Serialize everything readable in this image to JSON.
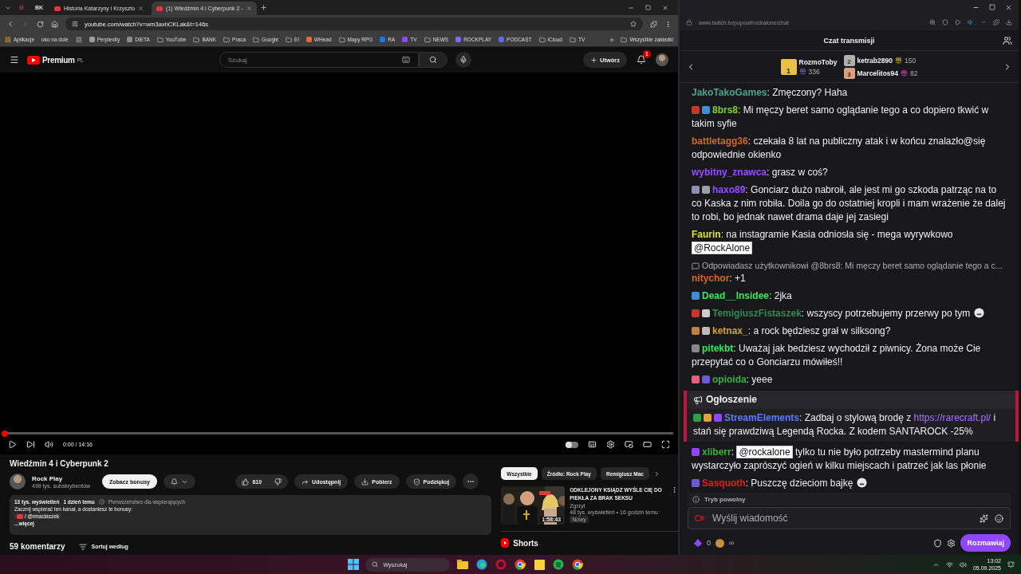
{
  "browser": {
    "tabs": [
      {
        "kind": "pinned",
        "label": "G",
        "selected": false
      },
      {
        "kind": "pinned",
        "label": "BK",
        "selected": false
      },
      {
        "kind": "page",
        "label": "Historia Katarzyny i Krzyszto",
        "selected": false
      },
      {
        "kind": "page",
        "label": "(1) Wiedźmin 4 i Cyberpunk 2 -",
        "selected": true
      }
    ],
    "url": "youtube.com/watch?v=wm3axhCKLak&t=146s",
    "bookmarks": [
      {
        "kind": "apps",
        "label": "Aplikacje"
      },
      {
        "kind": "text",
        "label": "oko na dole"
      },
      {
        "kind": "grid"
      },
      {
        "kind": "site",
        "label": "Perplexity",
        "color": "#9aa0a6"
      },
      {
        "kind": "site",
        "label": "DIETA",
        "color": "#8d8d8d"
      },
      {
        "kind": "folder",
        "label": "YouTube"
      },
      {
        "kind": "folder",
        "label": "BANK"
      },
      {
        "kind": "folder",
        "label": "Praca"
      },
      {
        "kind": "folder",
        "label": "Google"
      },
      {
        "kind": "folder",
        "label": "El"
      },
      {
        "kind": "site",
        "label": "WHead",
        "color": "#e06a3a"
      },
      {
        "kind": "folder",
        "label": "Mapy RPG"
      },
      {
        "kind": "site",
        "label": "RA",
        "color": "#1877f2"
      },
      {
        "kind": "site",
        "label": "TV",
        "color": "#9146ff"
      },
      {
        "kind": "folder",
        "label": "NEWS"
      },
      {
        "kind": "site",
        "label": "ROCKPLAY",
        "color": "#7b6cf0"
      },
      {
        "kind": "site",
        "label": "PODCAST",
        "color": "#5b6cf0"
      },
      {
        "kind": "folder",
        "label": "iCloud"
      },
      {
        "kind": "folder",
        "label": "TV"
      }
    ],
    "more_bookmarks": "»",
    "all_bookmarks": "Wszystkie zakładki"
  },
  "youtube": {
    "logo": "Premium",
    "region": "PL",
    "search_placeholder": "Szukaj",
    "create": "Utwórz",
    "notifications": "1",
    "player": {
      "level": 0,
      "time": "0:00 / 14:16"
    },
    "video": {
      "title": "Wiedźmin 4 i Cyberpunk 2",
      "channel": "Rock Play",
      "subscribers": "499 tys. subskrybentów",
      "bonus_button": "Zobacz bonusy",
      "likes": "610",
      "actions": [
        {
          "kind": "share",
          "label": "Udostępnij"
        },
        {
          "kind": "download",
          "label": "Pobierz"
        },
        {
          "kind": "thanks",
          "label": "Podziękuj"
        }
      ]
    },
    "description": {
      "views": "13 tys. wyświetleń",
      "age": "1 dzień temu",
      "priority": "Pierwszeństwo dla wspierających",
      "line": "Zacznij wspierać ten kanał, a dostaniesz te bonusy:",
      "handle": "/ @rmaciaszek",
      "more": "...więcej"
    },
    "comments": {
      "count": "59 komentarzy",
      "sort": "Sortuj według"
    },
    "chips": [
      {
        "label": "Wszystkie",
        "selected": true
      },
      {
        "label": "Źródło: Rock Play",
        "selected": false
      },
      {
        "label": "Remigiusz Mac",
        "selected": false
      }
    ],
    "recommended": [
      {
        "title": "ODKLEJONY KSIĄDZ WYŚLE CIĘ DO PIEKŁA ZA BRAK SEKSU",
        "channel": "Zgrzyt",
        "meta": "48 tys. wyświetleń • 16 godzin temu",
        "badge": "Nowy",
        "duration": "1:58:43"
      }
    ],
    "shorts": "Shorts"
  },
  "twitch": {
    "url": "www.twitch.tv/popout/rockalone/chat",
    "title": "Czat transmisji",
    "separator": ":",
    "leaders": [
      {
        "rank": "1",
        "name": "RozmoToby",
        "count": "336"
      },
      {
        "rank": "2",
        "name": "ketrab2890",
        "count": "150"
      },
      {
        "rank": "3",
        "name": "Marcelitos94",
        "count": "82"
      }
    ],
    "chat": [
      {
        "kind": "message",
        "user": "JakoTakoGames",
        "color": "#4fa28e",
        "parts": [
          {
            "kind": "text",
            "text": "Zmęczony? Haha"
          }
        ]
      },
      {
        "kind": "message",
        "user": "8brs8",
        "color": "#7fd13b",
        "badges": [
          {
            "color": "#c0392b"
          },
          {
            "color": "#3a8fd6"
          }
        ],
        "parts": [
          {
            "kind": "text",
            "text": "Mi męczy beret samo oglądanie tego a co dopiero tkwić w takim syfie"
          }
        ]
      },
      {
        "kind": "message",
        "user": "battletagg36",
        "color": "#d2692a",
        "parts": [
          {
            "kind": "text",
            "text": "czekała 8 lat na publiczny atak i w końcu znalazło@się odpowiednie okienko"
          }
        ]
      },
      {
        "kind": "message",
        "user": "wybitny_znawca",
        "color": "#9a4dff",
        "parts": [
          {
            "kind": "text",
            "text": "grasz w coś?"
          }
        ]
      },
      {
        "kind": "message",
        "user": "haxo89",
        "color": "#9a4dff",
        "badges": [
          {
            "color": "#8a8fb0"
          },
          {
            "color": "#9aa0a6"
          }
        ],
        "parts": [
          {
            "kind": "text",
            "text": "Gonciarz dużo nabroił, ale jest mi go szkoda patrząc na to co Kaska z nim robiła. Doila go do ostatniej kropli i mam wrażenie że dalej to robi, bo jednak nawet drama daje jej zasiegi"
          }
        ]
      },
      {
        "kind": "message",
        "user": "Faurin",
        "color": "#dfe32d",
        "parts": [
          {
            "kind": "text",
            "text": "na instagramie Kasia odniosła się - mega wyrywkowo"
          },
          {
            "kind": "mention",
            "text": "@RockAlone"
          }
        ]
      },
      {
        "kind": "reply",
        "text": "Odpowiadasz użytkownikowi @8brs8: Mi męczy beret samo oglądanie tego a c..."
      },
      {
        "kind": "message",
        "user": "nitychor",
        "color": "#d2692a",
        "parts": [
          {
            "kind": "text",
            "text": "+1"
          }
        ]
      },
      {
        "kind": "message",
        "user": "Dead__Insidee",
        "color": "#3ee65a",
        "badges": [
          {
            "color": "#3a8fd6"
          }
        ],
        "parts": [
          {
            "kind": "text",
            "text": "2jka"
          }
        ]
      },
      {
        "kind": "message",
        "user": "TemigiuszFistaszek",
        "color": "#2e8b57",
        "badges": [
          {
            "color": "#c0392b"
          },
          {
            "color": "#cccccc"
          }
        ],
        "parts": [
          {
            "kind": "text",
            "text": "wszyscy potrzebujemy przerwy po tym"
          },
          {
            "kind": "emote"
          }
        ]
      },
      {
        "kind": "message",
        "user": "ketnax_",
        "color": "#d4a52a",
        "badges": [
          {
            "color": "#c08040"
          },
          {
            "color": "#bbbbbb"
          }
        ],
        "parts": [
          {
            "kind": "text",
            "text": "a rock będziesz grał w silksong?"
          }
        ]
      },
      {
        "kind": "message",
        "user": "pitekbt",
        "color": "#3ee65a",
        "badges": [
          {
            "color": "#888888"
          }
        ],
        "parts": [
          {
            "kind": "text",
            "text": "Uważaj jak bedziesz wychodził z piwnicy. Żona może Cie przepytać co o Gonciarzu mówiłeś!!"
          }
        ]
      },
      {
        "kind": "message",
        "user": "opioida",
        "color": "#3cb043",
        "badges": [
          {
            "color": "#e06080"
          },
          {
            "color": "#6a5acd"
          }
        ],
        "parts": [
          {
            "kind": "text",
            "text": "yeee"
          }
        ]
      },
      {
        "kind": "announcement",
        "label": "Ogłoszenie",
        "user": "StreamElements",
        "color": "#5b7cfa",
        "badges": [
          {
            "color": "#2ea043"
          },
          {
            "color": "#e0a040"
          },
          {
            "color": "#9147ff"
          }
        ],
        "parts": [
          {
            "kind": "text",
            "text": "Zadbaj o stylową brodę z "
          },
          {
            "kind": "link",
            "text": "https://rarecraft.pl/"
          },
          {
            "kind": "text",
            "text": " i stań się prawdziwą Legendą Rocka. Z kodem SANTAROCK -25%"
          }
        ]
      },
      {
        "kind": "message",
        "user": "xliberr",
        "color": "#3cb043",
        "badges": [
          {
            "color": "#9147ff"
          }
        ],
        "parts": [
          {
            "kind": "mention",
            "text": "@rockalone"
          },
          {
            "kind": "text",
            "text": "tylko tu nie było potrzeby mastermind planu wystarczyło zaprószyć ogień w kilku miejscach i patrzeć jak las płonie"
          }
        ]
      },
      {
        "kind": "message",
        "user": "Sasquoth",
        "color": "#e0201e",
        "badges": [
          {
            "color": "#6a5acd"
          }
        ],
        "parts": [
          {
            "kind": "text",
            "text": "Puszczę dzieciom bajkę"
          },
          {
            "kind": "emote"
          }
        ]
      }
    ],
    "slow_mode": "Tryb powolny",
    "placeholder": "Wyślij wiadomość",
    "points": "0",
    "points_extra": "∞",
    "send": "Rozmawiaj"
  },
  "taskbar": {
    "search": "Wyszukaj",
    "apps": [
      {
        "kind": "files"
      },
      {
        "kind": "edge"
      },
      {
        "kind": "opera"
      },
      {
        "kind": "chrome"
      },
      {
        "kind": "notes"
      },
      {
        "kind": "spotify"
      },
      {
        "kind": "chrome"
      }
    ],
    "time": "13:02",
    "date": "05.09.2025"
  }
}
